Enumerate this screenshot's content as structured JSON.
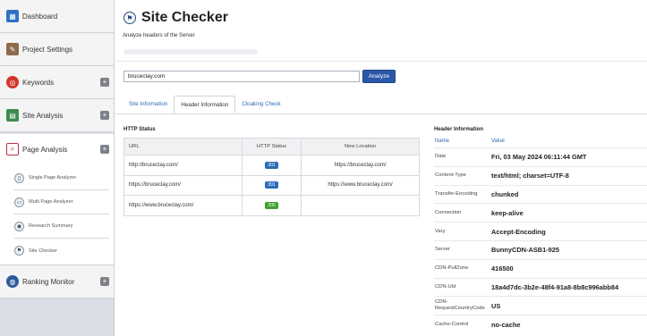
{
  "sidebar": {
    "items": [
      {
        "label": "Dashboard"
      },
      {
        "label": "Project Settings"
      },
      {
        "label": "Keywords"
      },
      {
        "label": "Site Analysis"
      },
      {
        "label": "Page Analysis"
      },
      {
        "label": "Ranking Monitor"
      }
    ],
    "expand_symbol": "+",
    "page_analysis_items": [
      {
        "label": "Single Page Analyzer"
      },
      {
        "label": "Multi Page Analyzer"
      },
      {
        "label": "Research Summary"
      },
      {
        "label": "Site Checker"
      }
    ]
  },
  "header": {
    "title": "Site Checker",
    "subtitle": "Analyze headers of the Server"
  },
  "search": {
    "value": "bruceclay.com",
    "button_label": "Analyze"
  },
  "tabs": [
    {
      "label": "Site Information",
      "active": false
    },
    {
      "label": "Header Information",
      "active": true
    },
    {
      "label": "Cloaking Check",
      "active": false
    }
  ],
  "http_status": {
    "title": "HTTP Status",
    "columns": [
      "URL",
      "HTTP Status",
      "New Location"
    ],
    "rows": [
      {
        "url": "http://bruceclay.com/",
        "status": "301",
        "status_color": "#2a6db5",
        "location": "https://bruceclay.com/"
      },
      {
        "url": "https://bruceclay.com/",
        "status": "301",
        "status_color": "#2a6db5",
        "location": "https://www.bruceclay.com/"
      },
      {
        "url": "https://www.bruceclay.com/",
        "status": "200",
        "status_color": "#3f9f2f",
        "location": ""
      }
    ]
  },
  "header_information": {
    "title": "Header Information",
    "columns": [
      "Name",
      "Value"
    ],
    "rows": [
      {
        "name": "Date",
        "value": "Fri, 03 May 2024 06:11:44 GMT"
      },
      {
        "name": "Content-Type",
        "value": "text/html; charset=UTF-8"
      },
      {
        "name": "Transfer-Encoding",
        "value": "chunked"
      },
      {
        "name": "Connection",
        "value": "keep-alive"
      },
      {
        "name": "Vary",
        "value": "Accept-Encoding"
      },
      {
        "name": "Server",
        "value": "BunnyCDN-ASB1-925"
      },
      {
        "name": "CDN-PullZone",
        "value": "416500"
      },
      {
        "name": "CDN-Uid",
        "value": "18a4d7dc-3b2e-48f4-91a8-8b8c996abb84"
      },
      {
        "name": "CDN-RequestCountryCode",
        "value": "US"
      },
      {
        "name": "Cache-Control",
        "value": "no-cache"
      }
    ]
  },
  "colors": {
    "accent": "#2b58a6",
    "link": "#2f6ab3",
    "sidebar_bg": "#d9dde6"
  }
}
